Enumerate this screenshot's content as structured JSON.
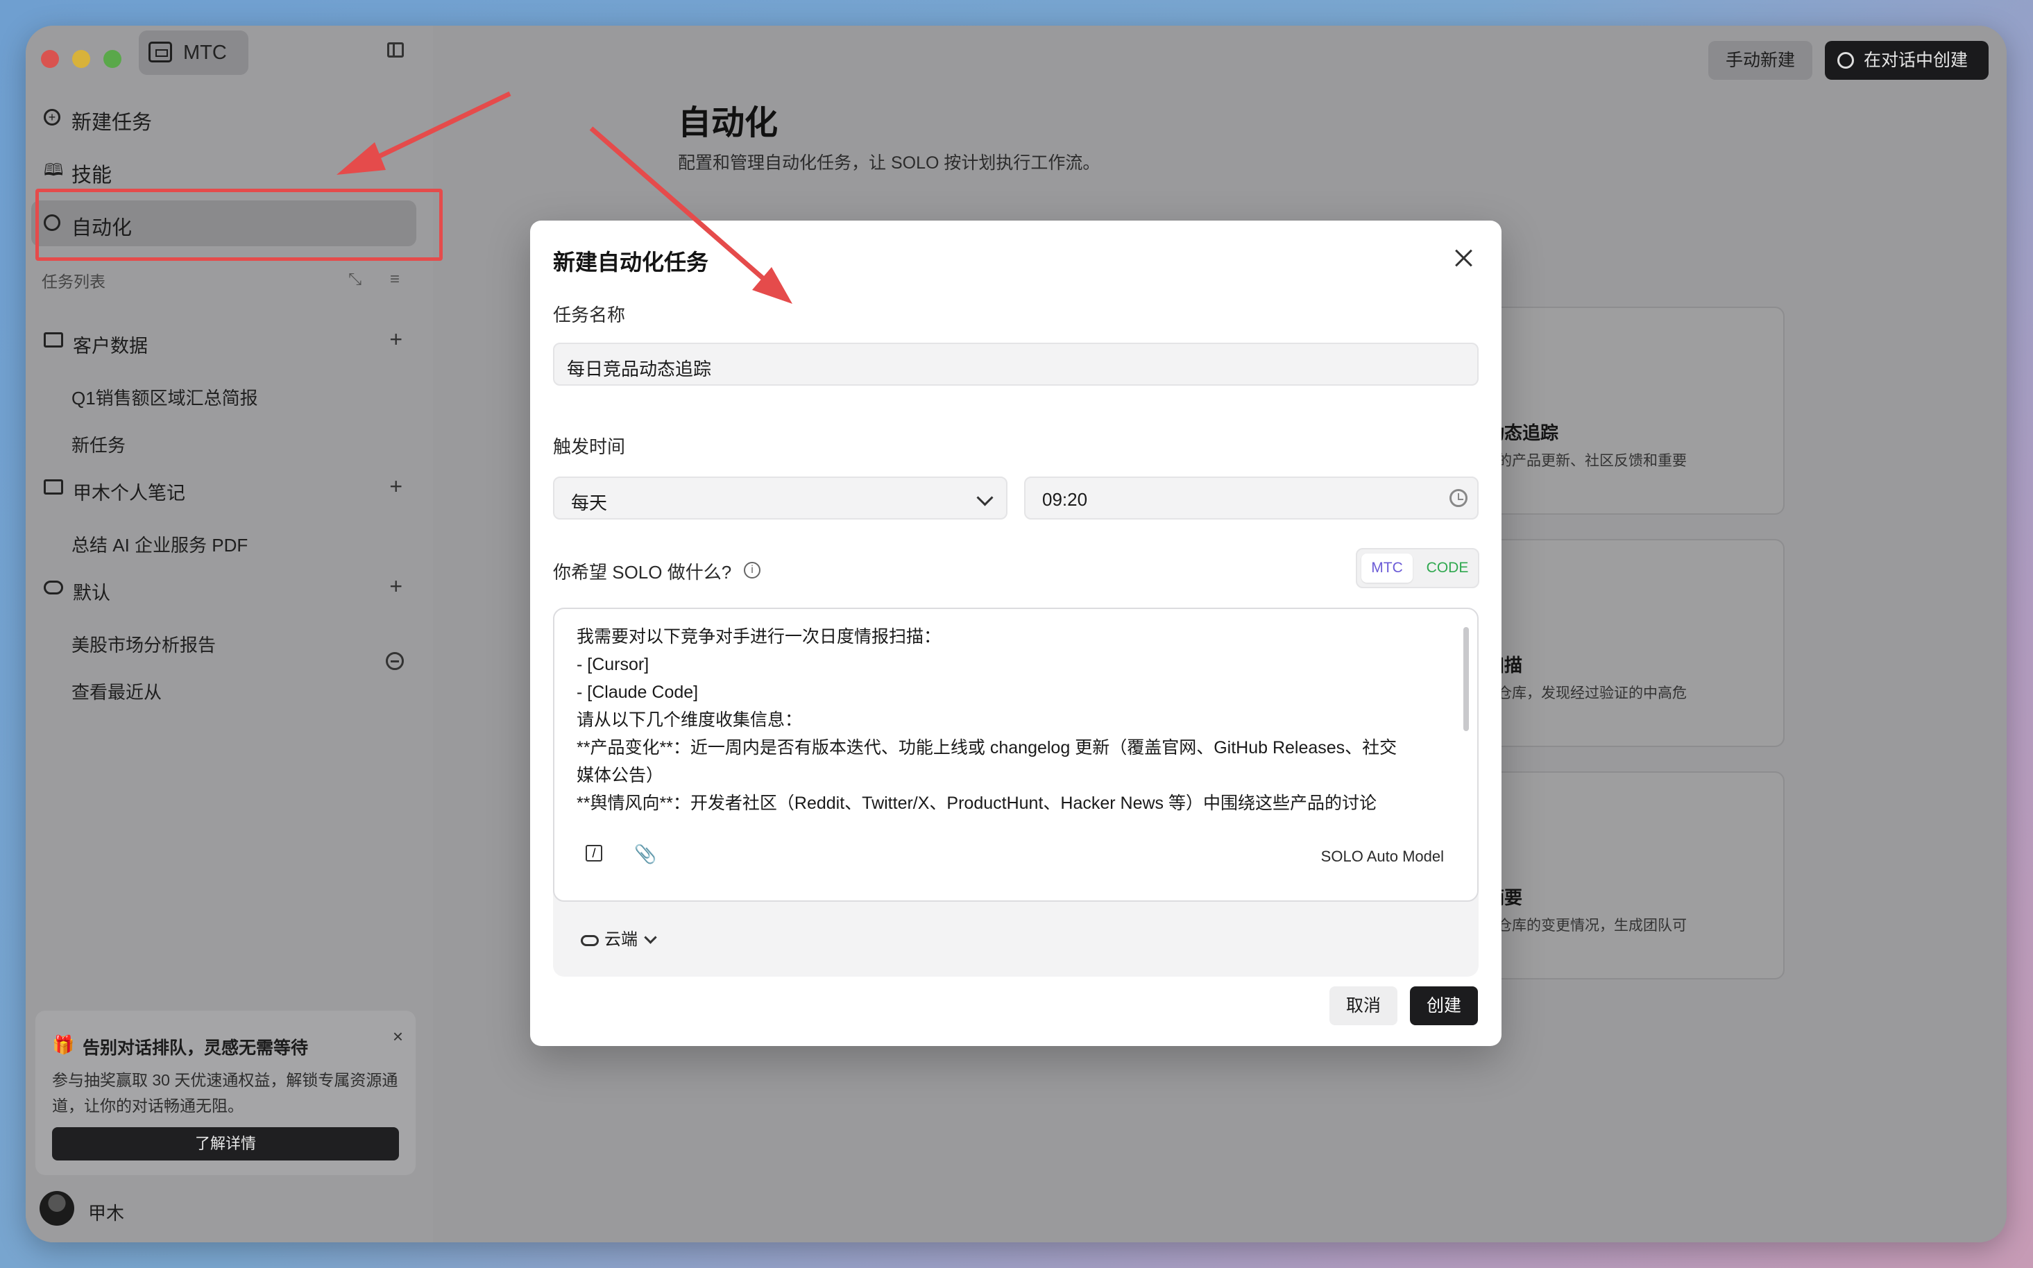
{
  "app": {
    "name": "MTC"
  },
  "sidebar": {
    "nav": [
      {
        "label": "新建任务",
        "icon": "add-task-icon"
      },
      {
        "label": "技能",
        "icon": "book-icon"
      },
      {
        "label": "自动化",
        "icon": "clock-icon",
        "active": true
      }
    ],
    "section_label": "任务列表",
    "folders": [
      {
        "label": "客户数据",
        "icon": "folder-icon",
        "tasks": [
          "Q1销售额区域汇总简报",
          "新任务"
        ]
      },
      {
        "label": "甲木个人笔记",
        "icon": "folder-icon",
        "tasks": [
          "总结 AI 企业服务 PDF"
        ]
      },
      {
        "label": "默认",
        "icon": "cloud-icon",
        "tasks": [
          "美股市场分析报告",
          "查看最近从"
        ]
      }
    ],
    "promo": {
      "title": "告别对话排队，灵感无需等待",
      "desc": "参与抽奖赢取 30 天优速通权益，解锁专属资源通道，让你的对话畅通无阻。",
      "button": "了解详情"
    },
    "user": {
      "name": "甲木"
    }
  },
  "header": {
    "manual_new": "手动新建",
    "create_in_chat": "在对话中创建"
  },
  "main": {
    "title": "自动化",
    "subtitle": "配置和管理自动化任务，让 SOLO 按计划执行工作流。",
    "cards": [
      {
        "title": "品动态追踪",
        "desc": "竟品的产品更新、社区反馈和重要"
      },
      {
        "title": "洞扫描",
        "desc": "代码仓库，发现经过验证的中高危"
      },
      {
        "title": "更摘要",
        "desc": "代码仓库的变更情况，生成团队可\n日报"
      }
    ]
  },
  "modal": {
    "title": "新建自动化任务",
    "task_name_label": "任务名称",
    "task_name_value": "每日竞品动态追踪",
    "trigger_label": "触发时间",
    "frequency": "每天",
    "time": "09:20",
    "prompt_label": "你希望 SOLO 做什么?",
    "mode_options": [
      "MTC",
      "CODE"
    ],
    "prompt_lines": [
      "我需要对以下竞争对手进行一次日度情报扫描：",
      "- [Cursor]",
      "- [Claude Code]",
      "请从以下几个维度收集信息：",
      "**产品变化**：近一周内是否有版本迭代、功能上线或 changelog 更新（覆盖官网、GitHub Releases、社交",
      "媒体公告）",
      "**舆情风向**：开发者社区（Reddit、Twitter/X、ProductHunt、Hacker News 等）中围绕这些产品的讨论"
    ],
    "model": "SOLO Auto Model",
    "environment": "云端",
    "cancel": "取消",
    "create": "创建"
  },
  "colors": {
    "annotation": "#e54b4b",
    "accent_purple": "#6b5bd6",
    "accent_green": "#2fa84f"
  }
}
